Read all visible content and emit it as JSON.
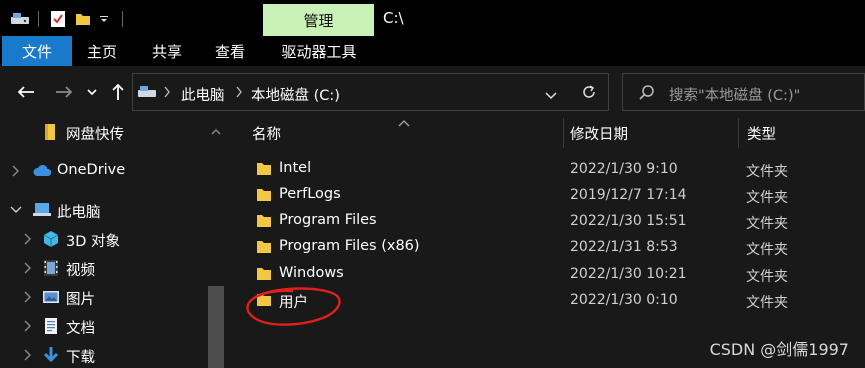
{
  "title_bar": {
    "manage_label": "管理",
    "window_title": "C:\\"
  },
  "ribbon": {
    "tabs": [
      "文件",
      "主页",
      "共享",
      "查看",
      "驱动器工具"
    ]
  },
  "address": {
    "breadcrumb": [
      "此电脑",
      "本地磁盘 (C:)"
    ],
    "search_placeholder": "搜索\"本地磁盘 (C:)\""
  },
  "nav_pane": {
    "items": [
      {
        "label": "网盘快传",
        "icon": "folder-icon"
      },
      {
        "label": "OneDrive",
        "icon": "cloud-icon"
      },
      {
        "label": "此电脑",
        "icon": "computer-icon"
      },
      {
        "label": "3D 对象",
        "icon": "cube-icon"
      },
      {
        "label": "视频",
        "icon": "video-icon"
      },
      {
        "label": "图片",
        "icon": "picture-icon"
      },
      {
        "label": "文档",
        "icon": "document-icon"
      },
      {
        "label": "下载",
        "icon": "download-icon"
      }
    ]
  },
  "file_list": {
    "columns": [
      "名称",
      "修改日期",
      "类型"
    ],
    "rows": [
      {
        "name": "Intel",
        "date": "2022/1/30 9:10",
        "type": "文件夹"
      },
      {
        "name": "PerfLogs",
        "date": "2019/12/7 17:14",
        "type": "文件夹"
      },
      {
        "name": "Program Files",
        "date": "2022/1/30 15:51",
        "type": "文件夹"
      },
      {
        "name": "Program Files (x86)",
        "date": "2022/1/31 8:53",
        "type": "文件夹"
      },
      {
        "name": "Windows",
        "date": "2022/1/30 10:21",
        "type": "文件夹"
      },
      {
        "name": "用户",
        "date": "2022/1/30 0:10",
        "type": "文件夹"
      }
    ]
  },
  "watermark": "CSDN @剑儒1997",
  "colors": {
    "accent": "#1979ca",
    "manage_tab": "#c9f0b5",
    "folder": "#f2c744",
    "annotation": "#e0201a",
    "background": "#191919"
  }
}
